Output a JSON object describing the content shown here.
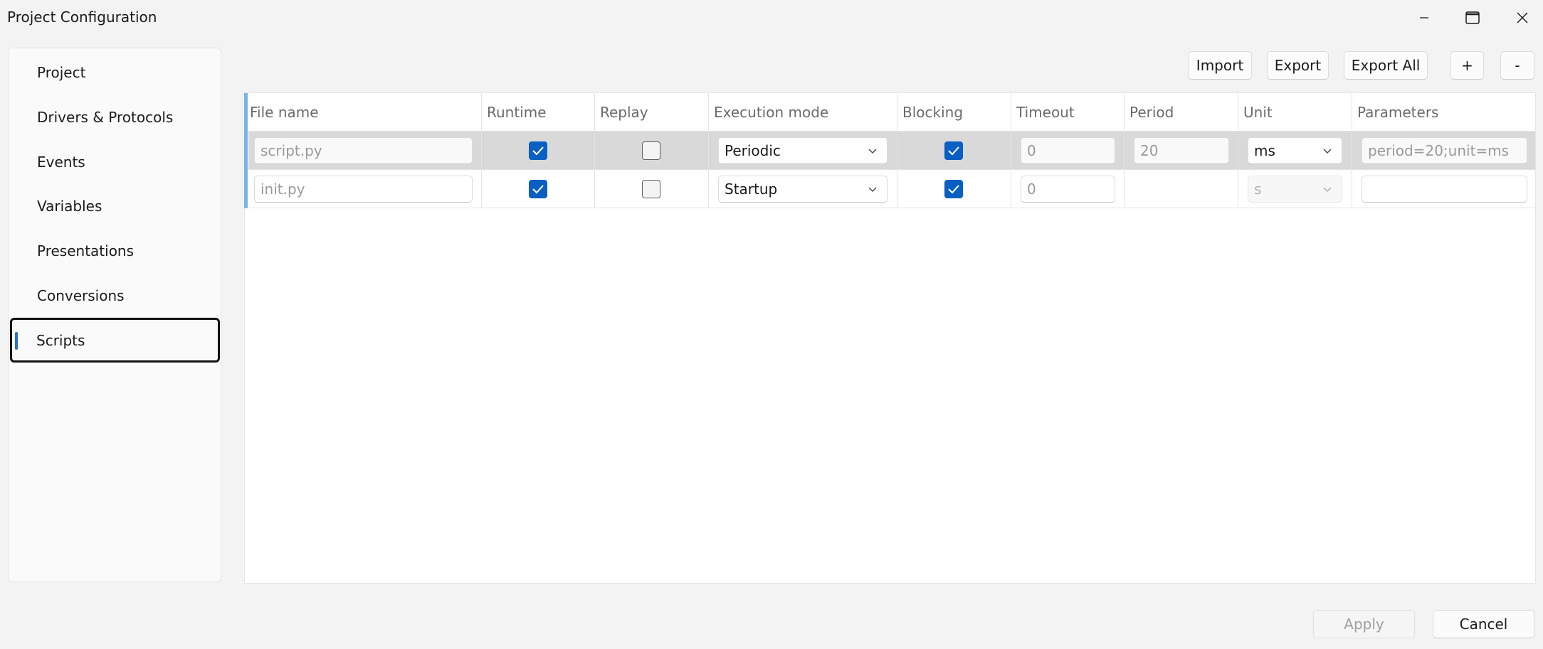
{
  "window": {
    "title": "Project Configuration",
    "controls": {
      "minimize": "minimize-icon",
      "maximize": "maximize-icon",
      "close": "close-icon"
    }
  },
  "sidebar": {
    "items": [
      {
        "label": "Project"
      },
      {
        "label": "Drivers & Protocols"
      },
      {
        "label": "Events"
      },
      {
        "label": "Variables"
      },
      {
        "label": "Presentations"
      },
      {
        "label": "Conversions"
      },
      {
        "label": "Scripts",
        "selected": true
      }
    ]
  },
  "toolbar": {
    "import": "Import",
    "export": "Export",
    "export_all": "Export All",
    "add": "+",
    "remove": "-"
  },
  "table": {
    "columns": [
      "File name",
      "Runtime",
      "Replay",
      "Execution mode",
      "Blocking",
      "Timeout",
      "Period",
      "Unit",
      "Parameters"
    ],
    "rows": [
      {
        "file_name": "script.py",
        "runtime": true,
        "replay": false,
        "execution_mode": "Periodic",
        "blocking": true,
        "timeout": "0",
        "period": "20",
        "unit": "ms",
        "parameters": "period=20;unit=ms",
        "selected": true
      },
      {
        "file_name": "init.py",
        "runtime": true,
        "replay": false,
        "execution_mode": "Startup",
        "blocking": true,
        "timeout": "0",
        "period": "",
        "unit": "s",
        "parameters": "",
        "selected": false
      }
    ]
  },
  "footer": {
    "apply": "Apply",
    "cancel": "Cancel"
  },
  "colors": {
    "accent": "#0a5fc2",
    "selection_indicator": "#2a6fc8",
    "row_selected_bg": "#d9d9d9"
  }
}
